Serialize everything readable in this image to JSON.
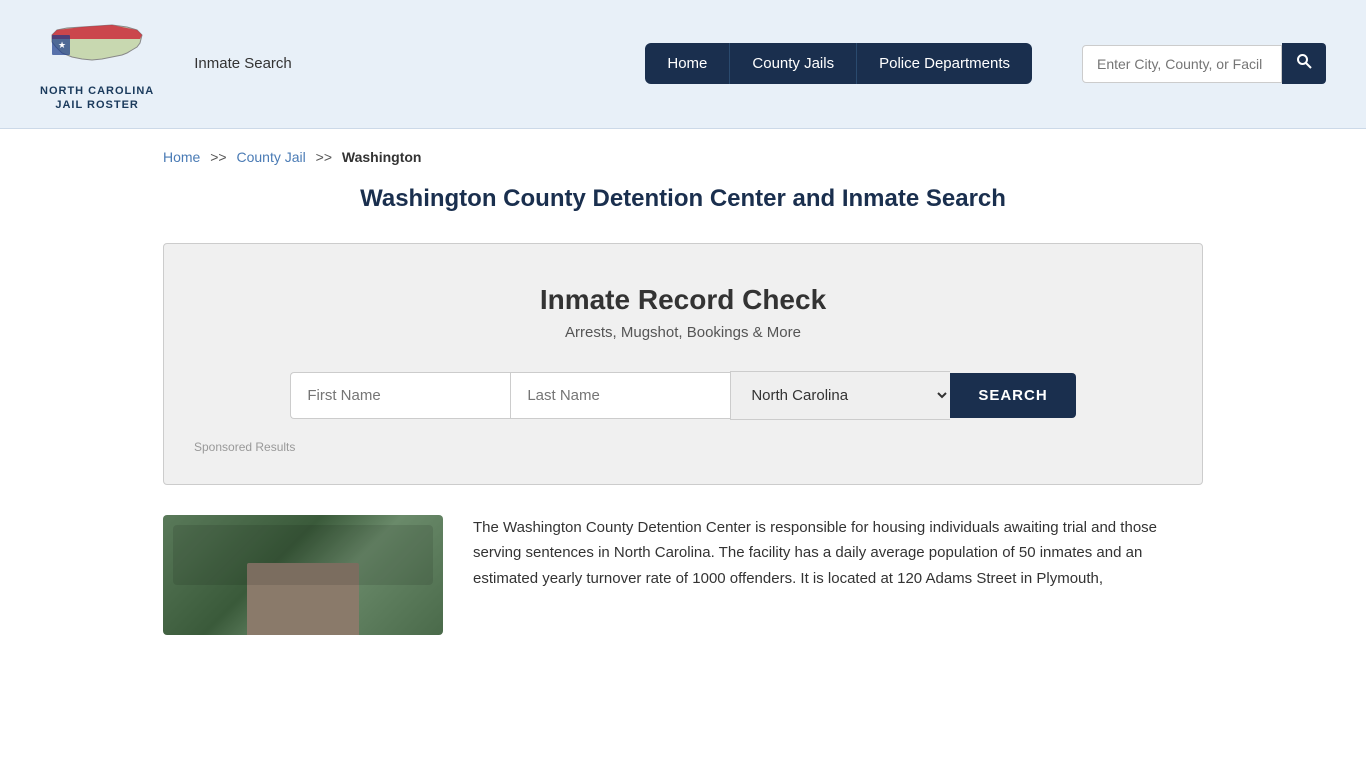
{
  "header": {
    "logo_line1": "NORTH CAROLINA",
    "logo_line2": "JAIL ROSTER",
    "inmate_search_label": "Inmate Search",
    "nav": {
      "home": "Home",
      "county_jails": "County Jails",
      "police_departments": "Police Departments"
    },
    "search_placeholder": "Enter City, County, or Facil"
  },
  "breadcrumb": {
    "home": "Home",
    "county_jail": "County Jail",
    "current": "Washington"
  },
  "page_title": "Washington County Detention Center and Inmate Search",
  "record_check": {
    "title": "Inmate Record Check",
    "subtitle": "Arrests, Mugshot, Bookings & More",
    "first_name_placeholder": "First Name",
    "last_name_placeholder": "Last Name",
    "state_value": "North Carolina",
    "search_btn": "SEARCH",
    "sponsored_text": "Sponsored Results"
  },
  "facility_description": "The Washington County Detention Center is responsible for housing individuals awaiting trial and those serving sentences in North Carolina. The facility has a daily average population of 50 inmates and an estimated yearly turnover rate of 1000 offenders. It is located at 120 Adams Street in Plymouth,"
}
